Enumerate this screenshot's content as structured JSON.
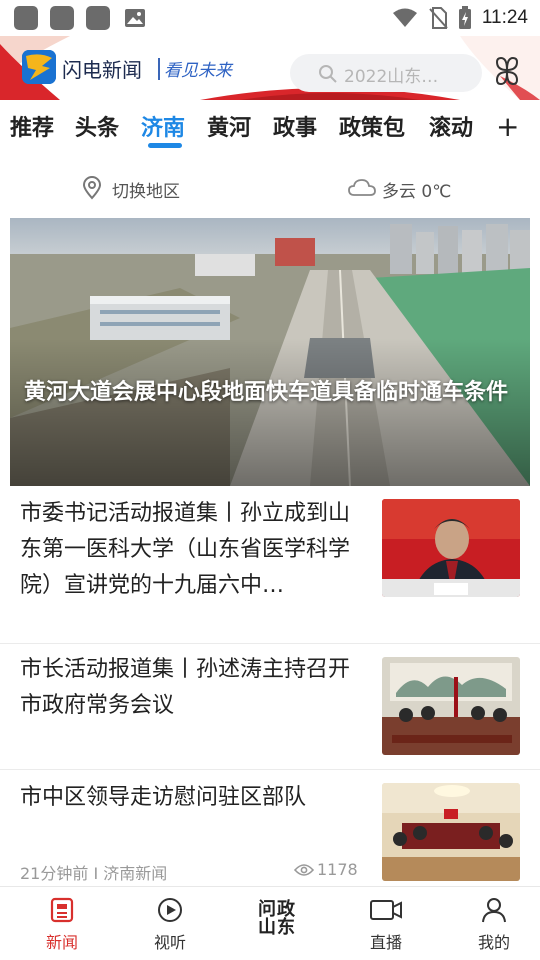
{
  "status_bar": {
    "time": "11:24"
  },
  "header": {
    "app_name": "闪电新闻",
    "slogan": "看见未来",
    "search_placeholder": "2022山东…"
  },
  "tabs": [
    {
      "label": "推荐"
    },
    {
      "label": "头条"
    },
    {
      "label": "济南",
      "active": true
    },
    {
      "label": "黄河"
    },
    {
      "label": "政事"
    },
    {
      "label": "政策包"
    },
    {
      "label": "滚动"
    }
  ],
  "tab_add": "+",
  "location": {
    "label": "切换地区"
  },
  "weather": {
    "label": "多云 0℃"
  },
  "hero": {
    "title": "黄河大道会展中心段地面快车道具备临时通车条件"
  },
  "news": [
    {
      "title": "市委书记活动报道集丨孙立成到山东第一医科大学（山东省医学科学院）宣讲党的十九届六中…"
    },
    {
      "title": "市长活动报道集丨孙述涛主持召开市政府常务会议"
    },
    {
      "title": "市中区领导走访慰问驻区部队",
      "time": "21分钟前",
      "source": "济南新闻",
      "views": "1178"
    }
  ],
  "bottom_nav": [
    {
      "label": "新闻",
      "icon": "news-icon",
      "active": true
    },
    {
      "label": "视听",
      "icon": "play-icon"
    },
    {
      "label": "问政山东",
      "icon": "wenzheng-logo"
    },
    {
      "label": "直播",
      "icon": "camera-icon"
    },
    {
      "label": "我的",
      "icon": "person-icon"
    }
  ],
  "colors": {
    "accent": "#1e88e5",
    "nav_active": "#d8302d",
    "header_red": "#d9262b"
  }
}
